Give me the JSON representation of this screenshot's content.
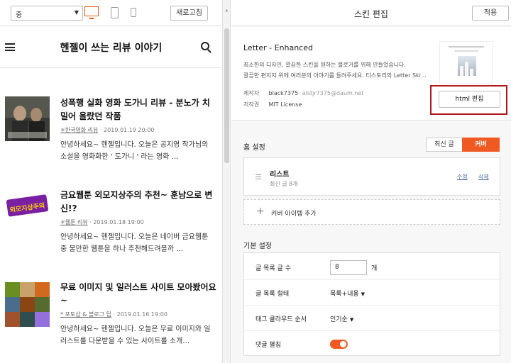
{
  "toolbar": {
    "zoom_value": "중",
    "refresh_label": "새로고침"
  },
  "blog": {
    "title": "헨젤이 쓰는 리뷰 이야기"
  },
  "posts": [
    {
      "title": "성폭행 실화 영화 도가니 리뷰 - 분노가 치밀어 올랐던 작품",
      "category": "✳한국영화 리뷰",
      "date": "2019.01.19 20:00",
      "excerpt": "안녕하세요~ 헨젤입니다. 오늘은 공지영 작가님의 소설을 영화화한 ' 도가니 ' 라는 영화 …"
    },
    {
      "title": "금요웹툰 외모지상주의 추천~ 훈남으로 변신!?",
      "category": "✳웹툰 리뷰",
      "date": "2019.01.18 19:00",
      "excerpt": "안녕하세요~ 헨젤입니다. 오늘은 네이버 금요웹툰 중 불만한 웹툰을 하나 추천해드려볼까 …"
    },
    {
      "title": "무료 이미지 및 일러스트 사이트 모아봤어요~",
      "category": "* 포토샵 & 블로그 팁",
      "date": "2019.01.16 19:00",
      "excerpt": "안녕하세요~ 헨젤입니다. 오늘은 무료 이미지와 일러스트를 다운받을 수 있는 사이트를 소개…"
    }
  ],
  "thumb2_text": "외모지상주의",
  "editor": {
    "title": "스킨 편집",
    "apply_label": "적용"
  },
  "skin": {
    "name": "Letter - Enhanced",
    "desc_line1": "최소한의 디자인, 깔끔한 스킨을 원하는 블로거를 위해 만들었습니다.",
    "desc_line2": "깔끔한 편지지 위에 여러분의 이야기를 들려주세요. 티스토리의 Letter Ski…",
    "maker_key": "제작자",
    "maker_value": "black7375",
    "maker_email": "alstjr7375@daum.net",
    "license_key": "저작권",
    "license_value": "MIT License",
    "html_edit_label": "html 편집"
  },
  "home": {
    "title": "홈 설정",
    "tab_latest": "최신 글",
    "tab_cover": "커버",
    "list_name": "리스트",
    "list_sub": "최신 글 8개",
    "edit_label": "수정",
    "delete_label": "삭제",
    "add_cover_label": "커버 아이템 추가"
  },
  "basic": {
    "title": "기본 설정",
    "rows": [
      {
        "key": "글 목록 글 수",
        "value": "8",
        "unit": "개"
      },
      {
        "key": "글 목록 형태",
        "value": "목록+내용"
      },
      {
        "key": "태그 클라우드 순서",
        "value": "인기순"
      },
      {
        "key": "댓글 펼침"
      }
    ]
  },
  "colors": {
    "accent": "#f05a22",
    "highlight": "#b3161a"
  }
}
